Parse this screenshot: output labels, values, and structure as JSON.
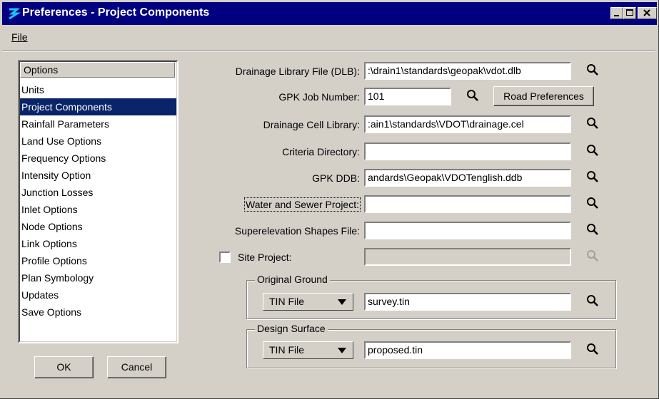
{
  "window": {
    "title": "Preferences - Project Components"
  },
  "menu": {
    "file": "File"
  },
  "options_list": {
    "header": "Options",
    "items": [
      "Units",
      "Project Components",
      "Rainfall Parameters",
      "Land Use Options",
      "Frequency Options",
      "Intensity Option",
      "Junction Losses",
      "Inlet Options",
      "Node Options",
      "Link Options",
      "Profile Options",
      "Plan Symbology",
      "Updates",
      "Save Options"
    ],
    "selected": "Project Components"
  },
  "buttons": {
    "ok": "OK",
    "cancel": "Cancel",
    "road_preferences": "Road Preferences"
  },
  "fields": {
    "drainage_library": {
      "label": "Drainage Library File (DLB):",
      "value": ":\\drain1\\standards\\geopak\\vdot.dlb"
    },
    "gpk_job_number": {
      "label": "GPK Job Number:",
      "value": "101"
    },
    "drainage_cell_library": {
      "label": "Drainage Cell Library:",
      "value": ":ain1\\standards\\VDOT\\drainage.cel"
    },
    "criteria_directory": {
      "label": "Criteria Directory:",
      "value": ""
    },
    "gpk_ddb": {
      "label": "GPK DDB:",
      "value": "andards\\Geopak\\VDOTenglish.ddb"
    },
    "water_sewer_project": {
      "label": "Water and Sewer Project:",
      "value": ""
    },
    "superelevation_shapes": {
      "label": "Superelevation Shapes File:",
      "value": ""
    },
    "site_project": {
      "label": "Site Project:",
      "value": "",
      "checked": false
    }
  },
  "original_ground": {
    "title": "Original Ground",
    "type": "TIN File",
    "value": "survey.tin"
  },
  "design_surface": {
    "title": "Design Surface",
    "type": "TIN File",
    "value": "proposed.tin"
  },
  "icons": {
    "browse": "magnifier-icon",
    "dropdown": "down-triangle-icon"
  },
  "colors": {
    "titlebar": "#000080",
    "selection": "#0a246a",
    "face": "#d4d0c8"
  }
}
